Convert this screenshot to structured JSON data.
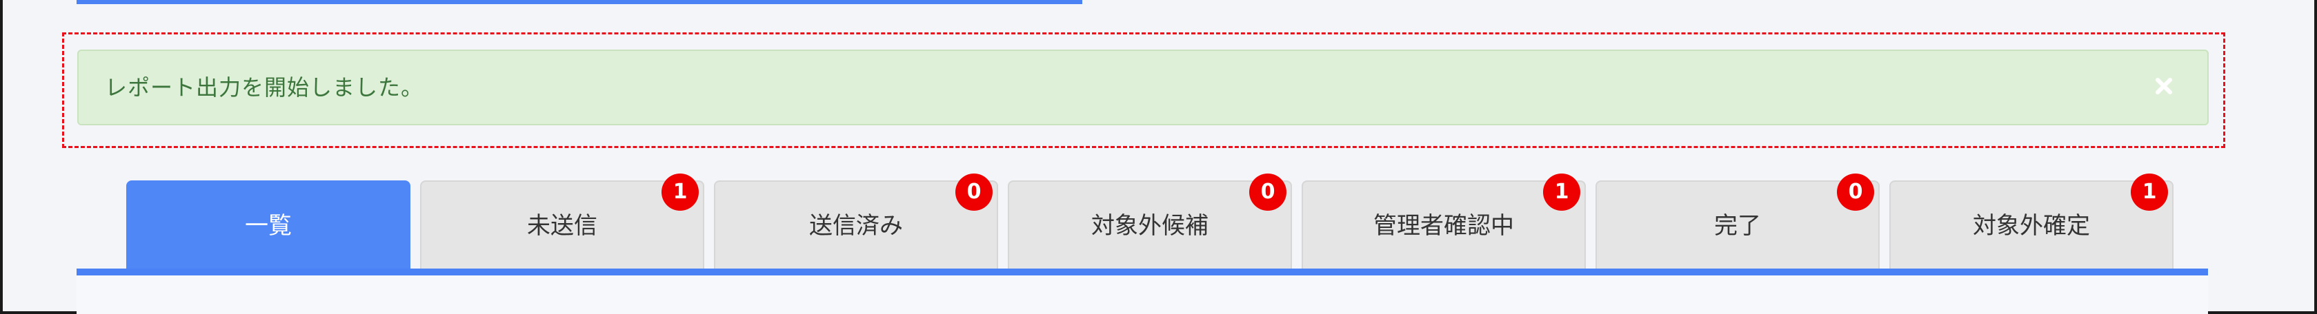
{
  "alert": {
    "message": "レポート出力を開始しました。",
    "close_icon": "close-icon"
  },
  "tabs": [
    {
      "label": "一覧",
      "active": true
    },
    {
      "label": "未送信",
      "badge": "1"
    },
    {
      "label": "送信済み",
      "badge": "0"
    },
    {
      "label": "対象外候補",
      "badge": "0"
    },
    {
      "label": "管理者確認中",
      "badge": "1"
    },
    {
      "label": "完了",
      "badge": "0"
    },
    {
      "label": "対象外確定",
      "badge": "1"
    }
  ],
  "colors": {
    "accent": "#4a82f6",
    "alert_bg": "#dff0d8",
    "alert_text": "#3c763d",
    "badge": "#ee0000",
    "highlight": "#e8101a"
  }
}
